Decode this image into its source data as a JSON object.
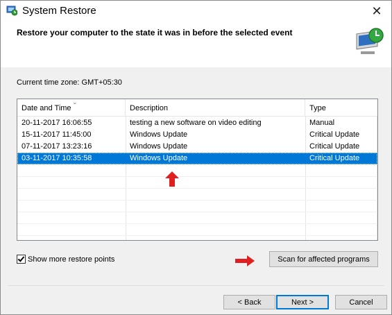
{
  "window": {
    "title": "System Restore",
    "header_text": "Restore your computer to the state it was in before the selected event",
    "close_glyph": "✕"
  },
  "timezone_label": "Current time zone: GMT+05:30",
  "list": {
    "columns": [
      "Date and Time",
      "Description",
      "Type"
    ],
    "rows": [
      {
        "date": "20-11-2017 16:06:55",
        "description": "testing a new software on video editing",
        "type": "Manual",
        "selected": false
      },
      {
        "date": "15-11-2017 11:45:00",
        "description": "Windows Update",
        "type": "Critical Update",
        "selected": false
      },
      {
        "date": "07-11-2017 13:23:16",
        "description": "Windows Update",
        "type": "Critical Update",
        "selected": false
      },
      {
        "date": "03-11-2017 10:35:58",
        "description": "Windows Update",
        "type": "Critical Update",
        "selected": true
      }
    ]
  },
  "show_more_label": "Show more restore points",
  "show_more_checked": true,
  "buttons": {
    "scan": "Scan for affected programs",
    "back": "< Back",
    "next": "Next >",
    "cancel": "Cancel"
  },
  "colors": {
    "selection": "#0078d7",
    "annotation_arrow": "#e02020"
  }
}
